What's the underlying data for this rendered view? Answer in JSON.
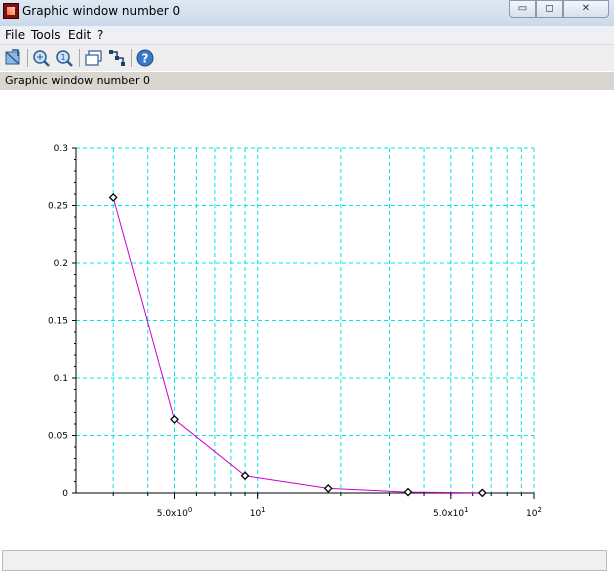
{
  "window": {
    "title": "Graphic window number 0",
    "controls": {
      "minimize": "▭",
      "maximize": "◻",
      "close": "✕"
    }
  },
  "menu": [
    {
      "label": "File"
    },
    {
      "label": "Tools"
    },
    {
      "label": "Edit"
    },
    {
      "label": "?"
    }
  ],
  "toolbar": [
    {
      "icon": "rotate-icon"
    },
    {
      "icon": "zoom-icon"
    },
    {
      "icon": "zoom-reset-icon"
    },
    {
      "icon": "new-window-icon"
    },
    {
      "icon": "datatip-icon"
    },
    {
      "icon": "help-icon"
    }
  ],
  "info_bar": {
    "text": "Graphic window number 0"
  },
  "status_bar": {
    "text": ""
  },
  "colors": {
    "grid": "#00e5e5",
    "line": "#cc00cc",
    "marker": "#000000"
  },
  "chart_data": {
    "type": "line",
    "x_scale": "log",
    "xlim": [
      2.2,
      100
    ],
    "ylim": [
      0,
      0.3
    ],
    "x": [
      3,
      5,
      9,
      18,
      35,
      60,
      65
    ],
    "y": [
      0.257,
      0.064,
      0.015,
      0.004,
      0.0008,
      0.0002,
      0.0001
    ],
    "marker_x": [
      3,
      5,
      9,
      18,
      35,
      65
    ],
    "marker_y": [
      0.257,
      0.064,
      0.015,
      0.004,
      0.0008,
      0.0001
    ],
    "y_ticks": [
      "0",
      "0.05",
      "0.1",
      "0.15",
      "0.2",
      "0.25",
      "0.3"
    ],
    "x_ticks": [
      {
        "value": 5,
        "base": "5.0x10",
        "exp": "0"
      },
      {
        "value": 10,
        "base": "10",
        "exp": "1"
      },
      {
        "value": 50,
        "base": "5.0x10",
        "exp": "1"
      },
      {
        "value": 100,
        "base": "10",
        "exp": "2"
      }
    ],
    "grid": true,
    "marker": "diamond"
  }
}
